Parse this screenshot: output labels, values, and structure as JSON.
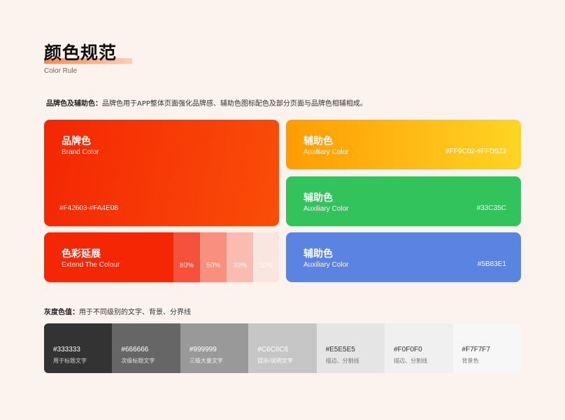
{
  "header": {
    "title": "颜色规范",
    "subtitle": "Color Rule"
  },
  "intro": {
    "label": "品牌色及辅助色：",
    "text": "品牌色用于APP整体页面强化品牌感、辅助色图标配色及部分页面与品牌色相辅相成。"
  },
  "brand": {
    "cn": "品牌色",
    "en": "Brand Color",
    "code": "#F42603-#FA4E08",
    "colors": [
      "#F42603",
      "#FA4E08"
    ]
  },
  "auxiliary": [
    {
      "cn": "辅助色",
      "en": "Auxiliary Color",
      "code": "#FF9C02-#FFD523",
      "colors": [
        "#FF9C02",
        "#FFD523"
      ]
    },
    {
      "cn": "辅助色",
      "en": "Auxiliary Color",
      "code": "#33C35C",
      "colors": [
        "#33C35C"
      ]
    },
    {
      "cn": "辅助色",
      "en": "Auxiliary Color",
      "code": "#5B83E1",
      "colors": [
        "#5B83E1"
      ]
    }
  ],
  "extend": {
    "cn": "色彩延展",
    "en": "Extend The Colour",
    "tints": [
      "80%",
      "50%",
      "30%",
      "10%"
    ]
  },
  "gray_section": {
    "label": "灰度色值：",
    "text": "用于不同级别的文字、背景、分界线"
  },
  "grays": [
    {
      "hex": "#333333",
      "use": "用于标题文字",
      "bg": "#333333",
      "fg": "#ffffff",
      "sub": "#cfcfcf"
    },
    {
      "hex": "#666666",
      "use": "次级标题文字",
      "bg": "#666666",
      "fg": "#ffffff",
      "sub": "#e0e0e0"
    },
    {
      "hex": "#999999",
      "use": "三级大量文字",
      "bg": "#999999",
      "fg": "#ffffff",
      "sub": "#f0f0f0"
    },
    {
      "hex": "#C6C6C6",
      "use": "提示/说明文字",
      "bg": "#C6C6C6",
      "fg": "#ffffff",
      "sub": "#ffffff"
    },
    {
      "hex": "#E5E5E5",
      "use": "描边、分割线",
      "bg": "#E5E5E5",
      "fg": "#333333",
      "sub": "#777777"
    },
    {
      "hex": "#F0F0F0",
      "use": "描边、分割线",
      "bg": "#F0F0F0",
      "fg": "#333333",
      "sub": "#777777"
    },
    {
      "hex": "#F7F7F7",
      "use": "背景色",
      "bg": "#F7F7F7",
      "fg": "#333333",
      "sub": "#777777"
    }
  ]
}
